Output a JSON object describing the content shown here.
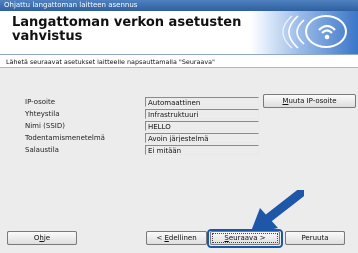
{
  "window": {
    "title": "Ohjattu langattoman laitteen asennus"
  },
  "header": {
    "title": "Langattoman verkon asetusten vahvistus"
  },
  "instruction": "Lähetä seuraavat asetukset laitteelle napsauttamalla \"Seuraava\"",
  "fields": [
    {
      "label": "IP-osoite",
      "value": "Automaattinen"
    },
    {
      "label": "Yhteystila",
      "value": "Infrastruktuuri"
    },
    {
      "label": "Nimi (SSID)",
      "value": "HELLO"
    },
    {
      "label": "Todentamismenetelmä",
      "value": "Avoin järjestelmä"
    },
    {
      "label": "Salaustila",
      "value": "Ei mitään"
    }
  ],
  "buttons": {
    "change_ip_accel": "M",
    "change_ip_rest": "uuta IP-osoite",
    "help_accel": "h",
    "help_pre": "O",
    "help_post": "je",
    "back_pre": "< ",
    "back_accel": "E",
    "back_rest": "dellinen",
    "next_accel": "S",
    "next_rest": "euraava >",
    "cancel": "Peruuta"
  },
  "icons": {
    "brand": "wifi-icon",
    "pointer": "arrow-icon"
  },
  "colors": {
    "accent": "#1f57a8",
    "titlebar": "#3a6db0",
    "banner_gradient_end": "#3b76c9"
  }
}
